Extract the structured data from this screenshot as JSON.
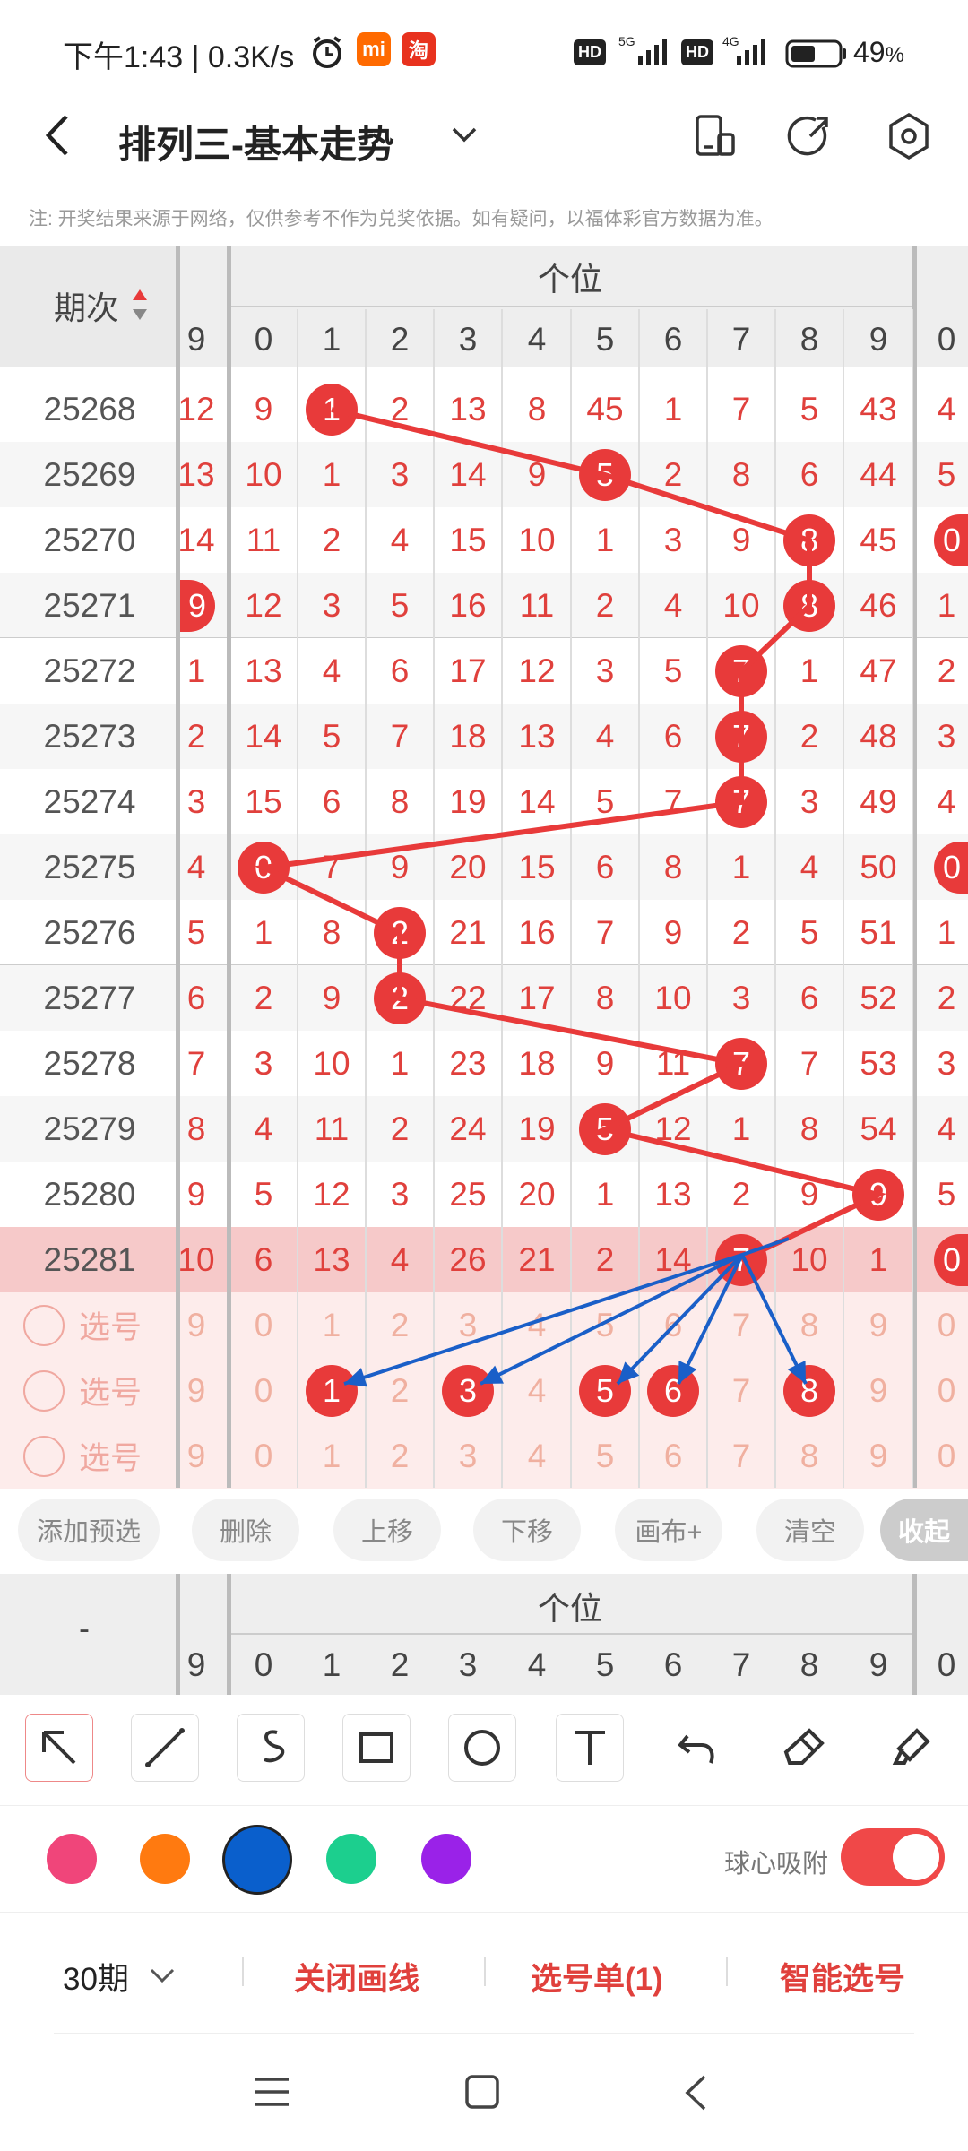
{
  "status_bar": {
    "time": "下午1:43 | 0.3K/s",
    "battery": "49",
    "battery_unit": "%",
    "hd": "HD",
    "net1": "5G",
    "net2": "4G"
  },
  "header": {
    "title": "排列三-基本走势",
    "back_icon": "chevron-left-icon",
    "dropdown_icon": "chevron-down-icon"
  },
  "notice": "注: 开奖结果来源于网络，仅供参考不作为兑奖依据。如有疑问，以福体彩官方数据为准。",
  "table": {
    "period_header": "期次",
    "section_header": "个位",
    "col_digits": [
      "9",
      "0",
      "1",
      "2",
      "3",
      "4",
      "5",
      "6",
      "7",
      "8",
      "9",
      "0"
    ],
    "rows": [
      {
        "period": "25268",
        "cells": [
          "12",
          "9",
          "1",
          "2",
          "13",
          "8",
          "45",
          "1",
          "7",
          "5",
          "43",
          "4"
        ],
        "ball": 2
      },
      {
        "period": "25269",
        "cells": [
          "13",
          "10",
          "1",
          "3",
          "14",
          "9",
          "5",
          "2",
          "8",
          "6",
          "44",
          "5"
        ],
        "ball": 6
      },
      {
        "period": "25270",
        "cells": [
          "14",
          "11",
          "2",
          "4",
          "15",
          "10",
          "1",
          "3",
          "9",
          "8",
          "45",
          "0"
        ],
        "ball": 9,
        "ball2": 11
      },
      {
        "period": "25271",
        "cells": [
          "9",
          "12",
          "3",
          "5",
          "16",
          "11",
          "2",
          "4",
          "10",
          "8",
          "46",
          "1"
        ],
        "ball": 9,
        "ball2": 0
      },
      {
        "period": "25272",
        "cells": [
          "1",
          "13",
          "4",
          "6",
          "17",
          "12",
          "3",
          "5",
          "7",
          "1",
          "47",
          "2"
        ],
        "ball": 8
      },
      {
        "period": "25273",
        "cells": [
          "2",
          "14",
          "5",
          "7",
          "18",
          "13",
          "4",
          "6",
          "7",
          "2",
          "48",
          "3"
        ],
        "ball": 8
      },
      {
        "period": "25274",
        "cells": [
          "3",
          "15",
          "6",
          "8",
          "19",
          "14",
          "5",
          "7",
          "7",
          "3",
          "49",
          "4"
        ],
        "ball": 8
      },
      {
        "period": "25275",
        "cells": [
          "4",
          "0",
          "7",
          "9",
          "20",
          "15",
          "6",
          "8",
          "1",
          "4",
          "50",
          "0"
        ],
        "ball": 1,
        "ball2": 11
      },
      {
        "period": "25276",
        "cells": [
          "5",
          "1",
          "8",
          "2",
          "21",
          "16",
          "7",
          "9",
          "2",
          "5",
          "51",
          "1"
        ],
        "ball": 3
      },
      {
        "period": "25277",
        "cells": [
          "6",
          "2",
          "9",
          "2",
          "22",
          "17",
          "8",
          "10",
          "3",
          "6",
          "52",
          "2"
        ],
        "ball": 3
      },
      {
        "period": "25278",
        "cells": [
          "7",
          "3",
          "10",
          "1",
          "23",
          "18",
          "9",
          "11",
          "7",
          "7",
          "53",
          "3"
        ],
        "ball": 8
      },
      {
        "period": "25279",
        "cells": [
          "8",
          "4",
          "11",
          "2",
          "24",
          "19",
          "5",
          "12",
          "1",
          "8",
          "54",
          "4"
        ],
        "ball": 6
      },
      {
        "period": "25280",
        "cells": [
          "9",
          "5",
          "12",
          "3",
          "25",
          "20",
          "1",
          "13",
          "2",
          "9",
          "9",
          "5"
        ],
        "ball": 10
      },
      {
        "period": "25281",
        "cells": [
          "10",
          "6",
          "13",
          "4",
          "26",
          "21",
          "2",
          "14",
          "7",
          "10",
          "1",
          "0"
        ],
        "ball": 8,
        "ball2": 11
      }
    ],
    "pick_label": "选号",
    "pick_digits": [
      "9",
      "0",
      "1",
      "2",
      "3",
      "4",
      "5",
      "6",
      "7",
      "8",
      "9",
      "0"
    ],
    "pick_balls": [
      2,
      4,
      6,
      7,
      9
    ]
  },
  "buttons": {
    "add_preselect": "添加预选",
    "delete": "删除",
    "move_up": "上移",
    "move_down": "下移",
    "canvas_plus": "画布+",
    "clear": "清空",
    "collapse": "收起"
  },
  "second_header": {
    "dash": "-",
    "section": "个位"
  },
  "tools": [
    "arrow-select-icon",
    "line-icon",
    "curve-icon",
    "rectangle-icon",
    "circle-icon",
    "text-icon",
    "undo-icon",
    "eraser-icon",
    "brush-clean-icon"
  ],
  "colors": {
    "accent": "#e83a3a",
    "swatches": [
      "#f0457a",
      "#ff7a10",
      "#0a5fcc",
      "#1ccf8e",
      "#9a22e8"
    ],
    "arrow": "#1a5fc8"
  },
  "snap_label": "球心吸附",
  "bottom": {
    "periods": "30期",
    "close_draw": "关闭画线",
    "pick_list": "选号单(1)",
    "smart_pick": "智能选号"
  }
}
